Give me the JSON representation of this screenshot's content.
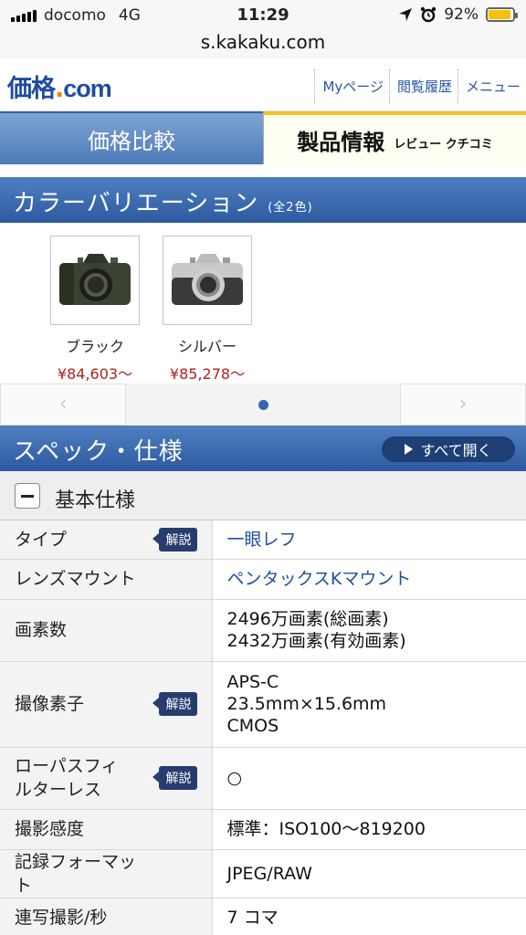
{
  "status_bar": {
    "carrier": "docomo",
    "network": "4G",
    "time": "11:29",
    "battery": "92%",
    "battery_level": 0.92,
    "location_icon": "location-arrow-icon",
    "alarm_icon": "alarm-clock-icon"
  },
  "browser": {
    "url": "s.kakaku.com"
  },
  "header": {
    "logo_kk": "価格",
    "logo_dot": ".",
    "logo_com": "com",
    "links": [
      "Myページ",
      "閲覧履歴",
      "メニュー"
    ]
  },
  "tabs": {
    "compare": "価格比較",
    "product": "製品情報",
    "product_sub": "レビュー クチコミ"
  },
  "colors_section": {
    "title": "カラーバリエーション",
    "count": "(全2色)",
    "items": [
      {
        "label": "ブラック",
        "price": "¥84,603〜"
      },
      {
        "label": "シルバー",
        "price": "¥85,278〜"
      }
    ],
    "prev": "‹",
    "next": "›"
  },
  "spec_section": {
    "title": "スペック・仕様",
    "open_all": "すべて開く",
    "group_title": "基本仕様",
    "badge": "解説",
    "rows": [
      {
        "key": "タイプ",
        "value": "一眼レフ"
      },
      {
        "key": "レンズマウント",
        "value": "ペンタックスKマウント"
      },
      {
        "key": "画素数",
        "value": "2496万画素(総画素)",
        "value2": "2432万画素(有効画素)"
      },
      {
        "key": "撮像素子",
        "value": "APS-C",
        "value2": "23.5mm×15.6mm",
        "value3": "CMOS"
      },
      {
        "key": "ローパスフィルターレス",
        "key_line1": "ローパスフィ",
        "key_line2": "ルターレス",
        "value": "○"
      },
      {
        "key": "撮影感度",
        "value": "標準：ISO100〜819200"
      },
      {
        "key": "記録フォーマット",
        "value": "JPEG/RAW"
      },
      {
        "key": "連写撮影/秒",
        "value": "7 コマ"
      }
    ]
  },
  "colors": {
    "brand_blue": "#1f4c9f",
    "price_red": "#b22020",
    "tab_yellow": "#f3c21e"
  }
}
